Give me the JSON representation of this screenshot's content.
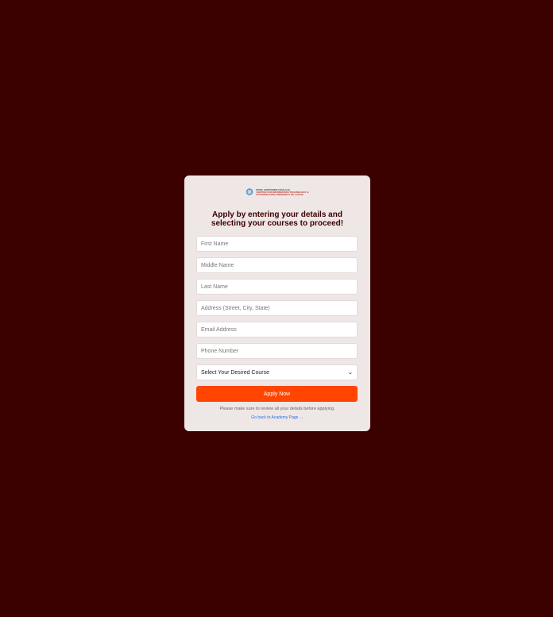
{
  "logo": {
    "line1": "PROF. AKINTUNDE OKULAJA",
    "line2": "CENTRE FOR INFORMATION TECHNOLOGY &",
    "line3": "SYSTEMS (CITS) UNIVERSITY OF LAGOS"
  },
  "heading": "Apply by entering your details and selecting your courses to proceed!",
  "form": {
    "first_name_placeholder": "First Name",
    "middle_name_placeholder": "Middle Name",
    "last_name_placeholder": "Last Name",
    "address_placeholder": "Address (Street, City, State)",
    "email_placeholder": "Email Address",
    "phone_placeholder": "Phone Number",
    "course_select_value": "Select Your Desired Course",
    "apply_label": "Apply Now"
  },
  "note": "Please make sure to review all your details before applying.",
  "back_link": "Go back to Academy Page →",
  "colors": {
    "background": "#3b0000",
    "card": "#efe6e6",
    "accent": "#ff4500",
    "link": "#1a73e8"
  }
}
